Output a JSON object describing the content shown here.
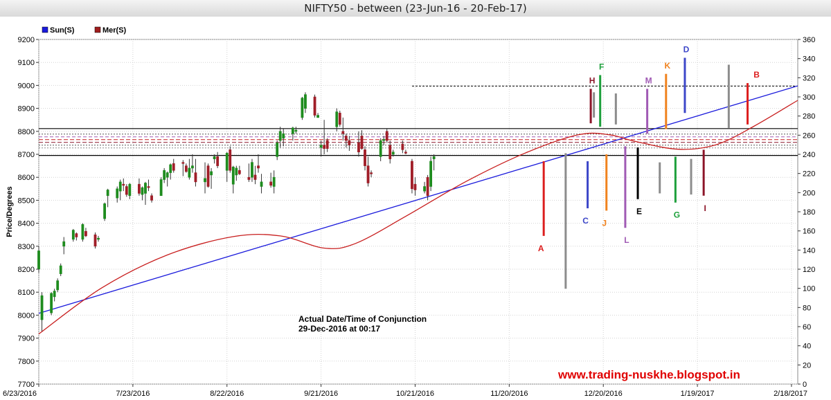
{
  "window": {
    "title": "NIFTY50 - between (23-Jun-16 - 20-Feb-17)"
  },
  "colors": {
    "sun": "#1a1adc",
    "mercury": "#c81e1e",
    "bull": "#1e8c1e",
    "bear": "#a01e28",
    "grey": "#8c8c8c",
    "A": "#dc1e1e",
    "B": "#dc1e1e",
    "C": "#3c46c8",
    "D": "#3c46c8",
    "E": "#000000",
    "F": "#1ea03c",
    "G": "#1ea03c",
    "H": "#8c1428",
    "I": "#8c1428",
    "J": "#f0821e",
    "K": "#f0821e",
    "L": "#a05ab4",
    "M": "#a05ab4"
  },
  "chart_data": {
    "type": "candlestick",
    "ylabel": "Price/Degrees",
    "y_left_range": [
      7700,
      9200
    ],
    "y_right_range": [
      0,
      360
    ],
    "y_left_ticks": [
      7700,
      7800,
      7900,
      8000,
      8100,
      8200,
      8300,
      8400,
      8500,
      8600,
      8700,
      8800,
      8900,
      9000,
      9100,
      9200
    ],
    "y_right_ticks": [
      0,
      20,
      40,
      60,
      80,
      100,
      120,
      140,
      160,
      180,
      200,
      220,
      240,
      260,
      280,
      300,
      320,
      340,
      360
    ],
    "x_range": [
      "2016-06-23",
      "2017-02-20"
    ],
    "x_ticks": [
      "6/23/2016",
      "7/23/2016",
      "8/22/2016",
      "9/21/2016",
      "10/21/2016",
      "11/20/2016",
      "12/20/2016",
      "1/19/2017",
      "2/18/2017"
    ],
    "legend": [
      "Sun(S)",
      "Mer(S)"
    ],
    "legend_position": "top-left",
    "grid": true,
    "horizontal_levels": [
      8695,
      8812
    ],
    "dashed_level": 8997,
    "annotation": {
      "line1": "Actual Date/Time of Conjunction",
      "line2": "29-Dec-2016 at 00:17"
    },
    "watermark": "www.trading-nuskhe.blogspot.in",
    "series": [
      {
        "name": "Sun(S)",
        "type": "line",
        "points": [
          [
            "2016-06-23",
            8008
          ],
          [
            "2017-02-20",
            8998
          ]
        ]
      },
      {
        "name": "Mer(S)",
        "type": "curve",
        "points": [
          [
            "2016-06-23",
            7918
          ],
          [
            "2016-07-13",
            8118
          ],
          [
            "2016-08-03",
            8262
          ],
          [
            "2016-08-24",
            8342
          ],
          [
            "2016-09-08",
            8345
          ],
          [
            "2016-09-22",
            8292
          ],
          [
            "2016-10-02",
            8312
          ],
          [
            "2016-10-18",
            8430
          ],
          [
            "2016-11-06",
            8580
          ],
          [
            "2016-11-25",
            8705
          ],
          [
            "2016-12-12",
            8785
          ],
          [
            "2016-12-22",
            8785
          ],
          [
            "2016-12-30",
            8757
          ],
          [
            "2017-01-13",
            8722
          ],
          [
            "2017-01-25",
            8742
          ],
          [
            "2017-02-06",
            8822
          ],
          [
            "2017-02-20",
            8935
          ]
        ]
      },
      {
        "name": "candles",
        "type": "ohlc",
        "columns": [
          "date",
          "open",
          "high",
          "low",
          "close"
        ],
        "rows": [
          [
            "2016-06-23",
            8200,
            8300,
            8185,
            8280
          ],
          [
            "2016-06-24",
            7980,
            8100,
            7930,
            8085
          ],
          [
            "2016-06-27",
            8010,
            8100,
            8000,
            8095
          ],
          [
            "2016-06-28",
            8080,
            8115,
            8060,
            8105
          ],
          [
            "2016-06-29",
            8110,
            8160,
            8100,
            8150
          ],
          [
            "2016-06-30",
            8180,
            8225,
            8170,
            8215
          ],
          [
            "2016-07-01",
            8300,
            8340,
            8265,
            8320
          ],
          [
            "2016-07-04",
            8330,
            8375,
            8320,
            8370
          ],
          [
            "2016-07-05",
            8355,
            8360,
            8325,
            8340
          ],
          [
            "2016-07-07",
            8330,
            8400,
            8320,
            8395
          ],
          [
            "2016-07-08",
            8365,
            8380,
            8340,
            8345
          ],
          [
            "2016-07-11",
            8350,
            8360,
            8290,
            8300
          ],
          [
            "2016-07-12",
            8330,
            8345,
            8320,
            8335
          ],
          [
            "2016-07-14",
            8420,
            8490,
            8410,
            8485
          ],
          [
            "2016-07-15",
            8520,
            8550,
            8470,
            8545
          ],
          [
            "2016-07-18",
            8510,
            8560,
            8490,
            8550
          ],
          [
            "2016-07-19",
            8540,
            8590,
            8500,
            8580
          ],
          [
            "2016-07-20",
            8570,
            8595,
            8540,
            8565
          ],
          [
            "2016-07-21",
            8560,
            8570,
            8515,
            8525
          ],
          [
            "2016-07-22",
            8520,
            8575,
            8505,
            8570
          ],
          [
            "2016-07-25",
            8570,
            8595,
            8520,
            8530
          ],
          [
            "2016-07-26",
            8525,
            8560,
            8500,
            8555
          ],
          [
            "2016-07-27",
            8530,
            8580,
            8480,
            8575
          ],
          [
            "2016-07-28",
            8560,
            8590,
            8540,
            8555
          ],
          [
            "2016-07-29",
            8520,
            8530,
            8490,
            8500
          ],
          [
            "2016-08-01",
            8520,
            8600,
            8520,
            8590
          ],
          [
            "2016-08-02",
            8590,
            8640,
            8575,
            8630
          ],
          [
            "2016-08-03",
            8600,
            8625,
            8560,
            8620
          ],
          [
            "2016-08-04",
            8620,
            8660,
            8590,
            8655
          ],
          [
            "2016-08-05",
            8660,
            8680,
            8620,
            8630
          ],
          [
            "2016-08-08",
            8665,
            8675,
            8605,
            8660
          ],
          [
            "2016-08-09",
            8650,
            8660,
            8620,
            8625
          ],
          [
            "2016-08-10",
            8600,
            8680,
            8590,
            8640
          ],
          [
            "2016-08-11",
            8640,
            8700,
            8620,
            8650
          ],
          [
            "2016-08-12",
            8620,
            8680,
            8560,
            8580
          ],
          [
            "2016-08-15",
            8580,
            8665,
            8530,
            8595
          ],
          [
            "2016-08-16",
            8650,
            8660,
            8555,
            8560
          ],
          [
            "2016-08-17",
            8610,
            8640,
            8550,
            8625
          ],
          [
            "2016-08-18",
            8680,
            8700,
            8660,
            8690
          ],
          [
            "2016-08-19",
            8690,
            8710,
            8640,
            8650
          ],
          [
            "2016-08-22",
            8630,
            8710,
            8580,
            8705
          ],
          [
            "2016-08-23",
            8720,
            8735,
            8620,
            8630
          ],
          [
            "2016-08-24",
            8570,
            8650,
            8530,
            8645
          ],
          [
            "2016-08-25",
            8610,
            8650,
            8585,
            8640
          ],
          [
            "2016-08-26",
            8630,
            8650,
            8610,
            8615
          ],
          [
            "2016-08-29",
            8600,
            8660,
            8580,
            8590
          ],
          [
            "2016-08-30",
            8600,
            8680,
            8580,
            8665
          ],
          [
            "2016-08-31",
            8610,
            8650,
            8570,
            8590
          ],
          [
            "2016-09-01",
            8650,
            8700,
            8620,
            8640
          ],
          [
            "2016-09-02",
            8560,
            8615,
            8530,
            8580
          ],
          [
            "2016-09-05",
            8580,
            8620,
            8555,
            8565
          ],
          [
            "2016-09-06",
            8560,
            8630,
            8530,
            8600
          ],
          [
            "2016-09-07",
            8690,
            8760,
            8675,
            8750
          ],
          [
            "2016-09-08",
            8760,
            8820,
            8730,
            8800
          ],
          [
            "2016-09-09",
            8770,
            8810,
            8735,
            8790
          ],
          [
            "2016-09-12",
            8790,
            8820,
            8760,
            8815
          ],
          [
            "2016-09-13",
            8800,
            8820,
            8790,
            8805
          ],
          [
            "2016-09-15",
            8860,
            8950,
            8850,
            8945
          ],
          [
            "2016-09-16",
            8900,
            8970,
            8880,
            8960
          ],
          [
            "2016-09-19",
            8950,
            8960,
            8860,
            8870
          ],
          [
            "2016-09-20",
            8860,
            8880,
            8860,
            8870
          ],
          [
            "2016-09-21",
            8730,
            8760,
            8690,
            8740
          ],
          [
            "2016-09-22",
            8740,
            8850,
            8700,
            8725
          ],
          [
            "2016-09-23",
            8760,
            8770,
            8710,
            8725
          ],
          [
            "2016-09-26",
            8820,
            8900,
            8800,
            8885
          ],
          [
            "2016-09-27",
            8880,
            8890,
            8820,
            8830
          ],
          [
            "2016-09-28",
            8800,
            8860,
            8760,
            8790
          ],
          [
            "2016-09-29",
            8780,
            8790,
            8730,
            8760
          ],
          [
            "2016-09-30",
            8760,
            8780,
            8715,
            8740
          ],
          [
            "2016-10-03",
            8750,
            8800,
            8690,
            8710
          ],
          [
            "2016-10-04",
            8780,
            8805,
            8720,
            8725
          ],
          [
            "2016-10-05",
            8720,
            8735,
            8630,
            8650
          ],
          [
            "2016-10-06",
            8650,
            8690,
            8560,
            8575
          ],
          [
            "2016-10-07",
            8620,
            8630,
            8600,
            8615
          ],
          [
            "2016-10-10",
            8690,
            8770,
            8670,
            8760
          ],
          [
            "2016-10-11",
            8760,
            8780,
            8740,
            8765
          ],
          [
            "2016-10-12",
            8800,
            8810,
            8750,
            8760
          ],
          [
            "2016-10-13",
            8740,
            8760,
            8660,
            8680
          ],
          [
            "2016-10-14",
            8700,
            8720,
            8690,
            8710
          ],
          [
            "2016-10-17",
            8745,
            8760,
            8705,
            8720
          ],
          [
            "2016-10-18",
            8710,
            8720,
            8700,
            8705
          ],
          [
            "2016-10-20",
            8670,
            8680,
            8530,
            8550
          ],
          [
            "2016-10-21",
            8570,
            8600,
            8520,
            8545
          ],
          [
            "2016-10-24",
            8540,
            8580,
            8530,
            8560
          ],
          [
            "2016-10-25",
            8600,
            8610,
            8500,
            8520
          ],
          [
            "2016-10-26",
            8560,
            8690,
            8540,
            8670
          ],
          [
            "2016-10-27",
            8680,
            8700,
            8630,
            8690
          ]
        ]
      },
      {
        "name": "vertical_markers",
        "type": "segments",
        "columns": [
          "label",
          "date",
          "top",
          "bottom",
          "color"
        ],
        "rows": [
          [
            "A",
            "2016-12-01",
            8670,
            8345,
            "A"
          ],
          [
            "",
            "2016-12-08",
            8705,
            8115,
            "grey"
          ],
          [
            "C",
            "2016-12-15",
            8670,
            8465,
            "C"
          ],
          [
            "H",
            "2016-12-16",
            8985,
            8835,
            "H"
          ],
          [
            "",
            "2016-12-17",
            8970,
            8860,
            "grey"
          ],
          [
            "F",
            "2016-12-19",
            9045,
            8820,
            "F"
          ],
          [
            "J",
            "2016-12-21",
            8700,
            8455,
            "J"
          ],
          [
            "",
            "2016-12-24",
            8965,
            8830,
            "grey"
          ],
          [
            "L",
            "2016-12-27",
            8735,
            8380,
            "L"
          ],
          [
            "E",
            "2016-12-31",
            8730,
            8505,
            "E"
          ],
          [
            "M",
            "2017-01-03",
            8985,
            8790,
            "M"
          ],
          [
            "",
            "2017-01-07",
            8665,
            8530,
            "grey"
          ],
          [
            "K",
            "2017-01-09",
            9050,
            8810,
            "K"
          ],
          [
            "G",
            "2017-01-12",
            8690,
            8490,
            "G"
          ],
          [
            "D",
            "2017-01-15",
            9120,
            8880,
            "D"
          ],
          [
            "",
            "2017-01-17",
            8680,
            8525,
            "grey"
          ],
          [
            "I",
            "2017-01-21",
            8720,
            8520,
            "I"
          ],
          [
            "",
            "2017-01-29",
            9090,
            8815,
            "grey"
          ],
          [
            "B",
            "2017-02-04",
            9010,
            8830,
            "B"
          ]
        ]
      }
    ]
  }
}
